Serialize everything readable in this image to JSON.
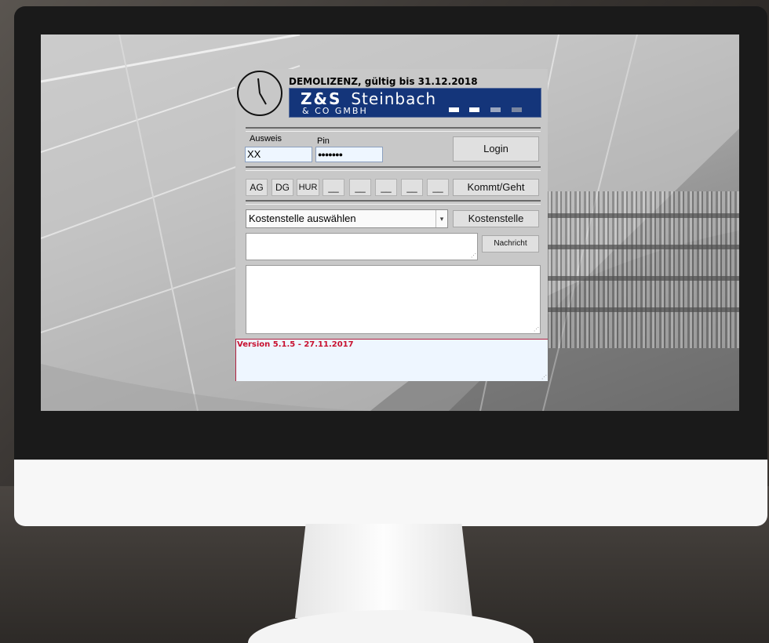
{
  "app": {
    "demo_license": "DEMOLIZENZ, gültig bis 31.12.2018",
    "logo": {
      "line1_bold": "Z&S",
      "line1": "Steinbach",
      "line2": "& CO GMBH"
    },
    "colors": {
      "logo_bg": "#14357a",
      "version_text": "#c8102e",
      "input_bg": "#eef6ff",
      "panel_bg": "#c8c8c8"
    }
  },
  "login": {
    "ausweis_label": "Ausweis",
    "ausweis_value": "XX",
    "pin_label": "Pin",
    "pin_value": "●●●●●●●",
    "login_button": "Login"
  },
  "quick_buttons": [
    "AG",
    "DG",
    "HUR",
    "__",
    "__",
    "__",
    "__",
    "__"
  ],
  "kommt_geht_button": "Kommt/Geht",
  "kostenstelle": {
    "selected": "Kostenstelle auswählen",
    "button": "Kostenstelle"
  },
  "nachricht_button": "Nachricht",
  "version": "Version 5.1.5 - 27.11.2017",
  "icons": {
    "clock": "clock-icon",
    "dropdown": "chevron-down-icon",
    "resize": "resize-grip-icon"
  }
}
